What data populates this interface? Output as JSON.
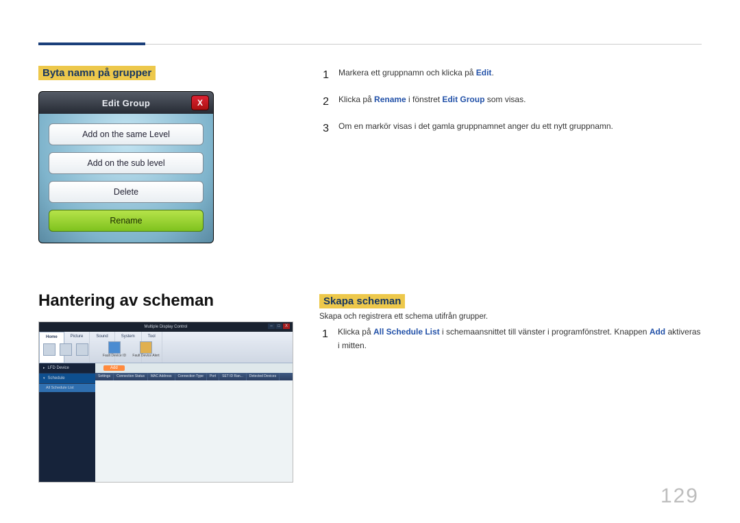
{
  "page_number": "129",
  "left": {
    "section1_title": "Byta namn på grupper",
    "dialog": {
      "title": "Edit Group",
      "close": "X",
      "options": [
        "Add on the same Level",
        "Add on the sub level",
        "Delete",
        "Rename"
      ]
    },
    "section2_title": "Hantering av scheman",
    "app": {
      "title": "Multiple Display Control",
      "tabs": [
        "Home",
        "Picture",
        "Sound",
        "System",
        "Tool"
      ],
      "fault1": "Fault Device ID",
      "fault2": "Fault Device Alert",
      "sidebar": {
        "item1": "LFD Device",
        "item2": "Schedule",
        "sub": "All Schedule List"
      },
      "add": "Add",
      "cols": [
        "Settings",
        "Connection Status",
        "MAC Address",
        "Connection Type",
        "Port",
        "SET ID Ran...",
        "Detected Devices"
      ]
    }
  },
  "right": {
    "step1_a": "Markera ett gruppnamn och klicka på ",
    "step1_b": "Edit",
    "step1_c": ".",
    "step2_a": "Klicka på ",
    "step2_b": "Rename",
    "step2_c": " i fönstret ",
    "step2_d": "Edit Group",
    "step2_e": " som visas.",
    "step3": "Om en markör visas i det gamla gruppnamnet anger du ett nytt gruppnamn.",
    "section2_title": "Skapa scheman",
    "desc": "Skapa och registrera ett schema utifrån grupper.",
    "s2step1_a": "Klicka på ",
    "s2step1_b": "All Schedule List",
    "s2step1_c": " i schemaansnittet till vänster i programfönstret. Knappen ",
    "s2step1_d": "Add",
    "s2step1_e": " aktiveras i mitten.",
    "n1": "1",
    "n2": "2",
    "n3": "3"
  }
}
